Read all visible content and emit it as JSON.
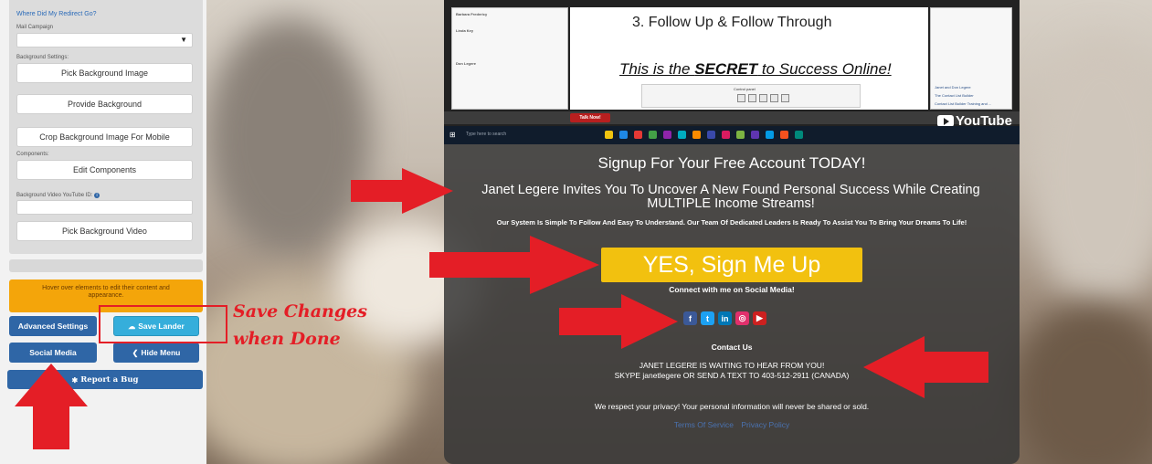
{
  "sidebar": {
    "redirect_link": "Where Did My Redirect Go?",
    "mail_campaign_label": "Mail Campaign",
    "mail_campaign_value": "",
    "background_settings_label": "Background Settings:",
    "pick_background_image": "Pick Background Image",
    "provide_background": "Provide Background",
    "crop_background": "Crop Background Image For Mobile",
    "components_label": "Components:",
    "edit_components": "Edit Components",
    "bg_video_label": "Background Video YouTube ID:",
    "bg_video_value": "",
    "pick_background_video": "Pick Background Video",
    "hover_note": "Hover over elements to edit their content and appearance.",
    "advanced_settings": "Advanced Settings",
    "save_lander": "Save Lander",
    "social_media": "Social Media",
    "hide_menu": "Hide Menu",
    "report_bug": "Report a Bug"
  },
  "video": {
    "slide_step": "3.  Follow Up & Follow Through",
    "slide_secret_prefix": "This is the ",
    "slide_secret_bold": "SECRET",
    "slide_secret_suffix": " to Success Online!",
    "control_panel_label": "Control panel",
    "talk_now": "Talk Now!",
    "youtube": "YouTube",
    "taskbar_search": "Type here to search",
    "left_rows": [
      "Barbara Fredericy",
      "Linda Key",
      "Don Legere"
    ],
    "right_rows": [
      "Janet and Don Legere",
      "The Contact List Builder",
      "Contact List Builder Training and ..."
    ]
  },
  "lander": {
    "headline": "Signup For Your Free Account TODAY!",
    "invite": "Janet Legere Invites You To Uncover A New Found Personal Success While Creating MULTIPLE Income Streams!",
    "system": "Our System Is Simple To Follow And Easy To Understand. Our Team Of Dedicated Leaders Is Ready To Assist You To Bring Your Dreams To Life!",
    "cta": "YES, Sign Me Up",
    "connect": "Connect with me on Social Media!",
    "contact_title": "Contact Us",
    "contact_line1": "JANET LEGERE IS WAITING TO HEAR FROM YOU!",
    "contact_line2": "SKYPE janetlegere OR SEND A TEXT TO 403-512-2911 (CANADA)",
    "privacy": "We respect your privacy! Your personal information will never be shared or sold.",
    "terms": "Terms Of Service",
    "privacy_policy": "Privacy Policy"
  },
  "social_icons": [
    {
      "name": "facebook-icon",
      "glyph": "f",
      "color": "#3b5998"
    },
    {
      "name": "twitter-icon",
      "glyph": "t",
      "color": "#1da1f2"
    },
    {
      "name": "linkedin-icon",
      "glyph": "in",
      "color": "#0077b5"
    },
    {
      "name": "instagram-icon",
      "glyph": "◎",
      "color": "#e1306c"
    },
    {
      "name": "youtube-icon",
      "glyph": "▶",
      "color": "#cd201f"
    }
  ],
  "annotation": {
    "text_line1": "Save Changes",
    "text_line2": "when Done",
    "color": "#e41e26"
  },
  "colors": {
    "cta": "#f2c10f",
    "hover_note": "#f4a50a",
    "button_blue": "#2f66a6",
    "button_cyan": "#35aedb"
  }
}
